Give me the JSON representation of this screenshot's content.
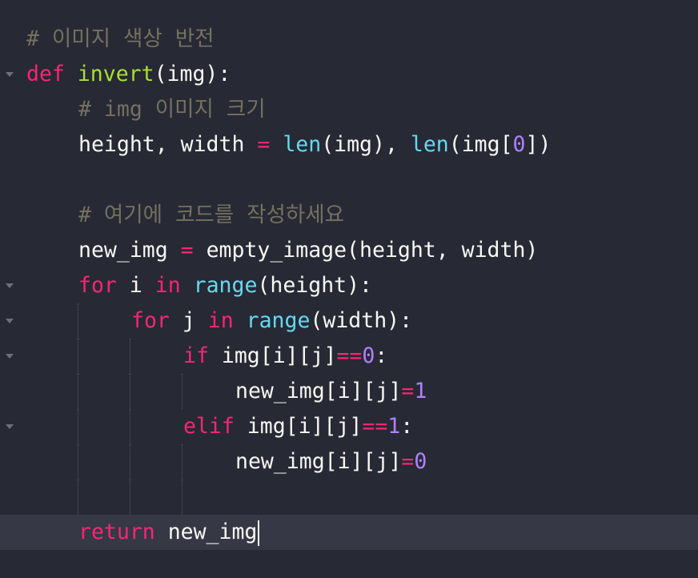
{
  "theme": {
    "background": "#272935",
    "current_line": "#363846",
    "comment": "#75715e",
    "keyword": "#f92672",
    "function": "#a6e22e",
    "builtin": "#66d9ef",
    "number": "#ae81ff",
    "text": "#f8f8f2"
  },
  "code": {
    "l1": {
      "comment": "# 이미지 색상 반전"
    },
    "l2": {
      "kw": "def",
      "sp": " ",
      "fn": "invert",
      "rest": "(img):"
    },
    "l3": {
      "comment": "# img 이미지 크기"
    },
    "l4": {
      "a": "height, width ",
      "eq": "=",
      "b": " ",
      "len1": "len",
      "c": "(img), ",
      "len2": "len",
      "d": "(img[",
      "n": "0",
      "e": "])"
    },
    "l6": {
      "comment": "# 여기에 코드를 작성하세요"
    },
    "l7": {
      "a": "new_img ",
      "eq": "=",
      "b": " empty_image(height, width)"
    },
    "l8": {
      "kw": "for",
      "a": " i ",
      "in": "in",
      "b": " ",
      "range": "range",
      "c": "(height):"
    },
    "l9": {
      "kw": "for",
      "a": " j ",
      "in": "in",
      "b": " ",
      "range": "range",
      "c": "(width):"
    },
    "l10": {
      "kw": "if",
      "a": " img[i][j]",
      "op": "==",
      "n": "0",
      "c": ":"
    },
    "l11": {
      "a": "new_img[i][j]",
      "op": "=",
      "n": "1"
    },
    "l12": {
      "kw": "elif",
      "a": " img[i][j]",
      "op": "==",
      "n": "1",
      "c": ":"
    },
    "l13": {
      "a": "new_img[i][j]",
      "op": "=",
      "n": "0"
    },
    "l15": {
      "kw": "return",
      "a": " new_img"
    }
  }
}
